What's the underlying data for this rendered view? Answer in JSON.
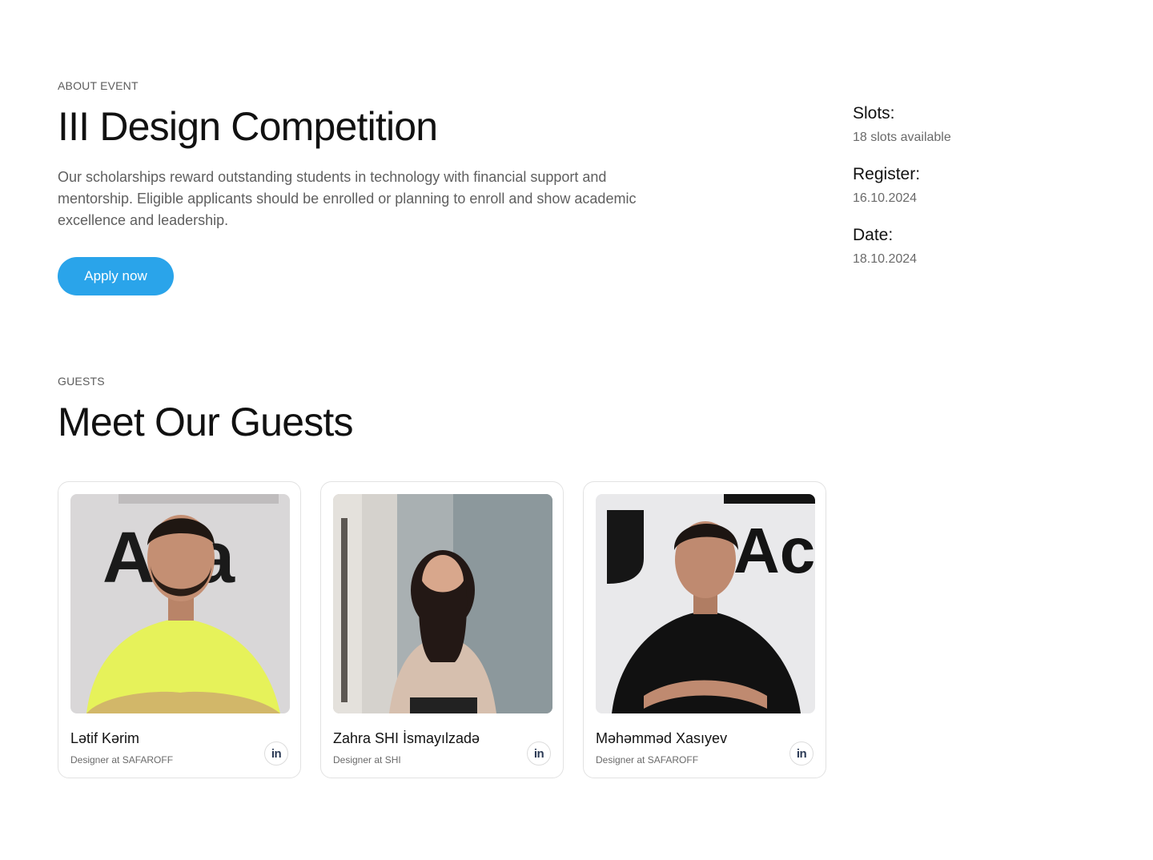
{
  "about": {
    "eyebrow": "ABOUT EVENT",
    "title": "III Design Competition",
    "description": "Our scholarships reward outstanding students in technology with financial support and mentorship. Eligible applicants should be enrolled or planning to enroll and show academic excellence and leadership.",
    "apply_label": "Apply now"
  },
  "meta": [
    {
      "label": "Slots:",
      "value": "18 slots available"
    },
    {
      "label": "Register:",
      "value": "16.10.2024"
    },
    {
      "label": "Date:",
      "value": "18.10.2024"
    }
  ],
  "guests_section": {
    "eyebrow": "GUESTS",
    "title": "Meet Our Guests"
  },
  "guests": [
    {
      "name": "Lətif Kərim",
      "role": "Designer at SAFAROFF",
      "linkedin_icon": "linkedin-icon"
    },
    {
      "name": "Zahra SHI İsmayılzadə",
      "role": "Designer at SHI",
      "linkedin_icon": "linkedin-icon"
    },
    {
      "name": "Məhəmməd Xasıyev",
      "role": "Designer at SAFAROFF",
      "linkedin_icon": "linkedin-icon"
    }
  ],
  "colors": {
    "accent": "#2aa4ea",
    "text": "#121212",
    "muted": "#6a6a6a",
    "border": "#e2e2e2"
  }
}
